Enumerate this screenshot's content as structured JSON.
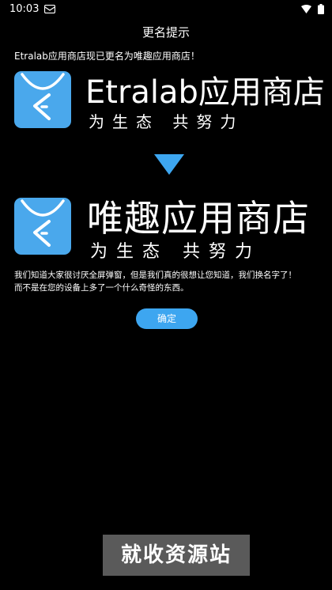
{
  "status_bar": {
    "time": "10:03",
    "icons": [
      "notification-icon",
      "wifi-icon",
      "battery-icon"
    ]
  },
  "dialog": {
    "title": "更名提示",
    "notice": "Etralab应用商店现已更名为唯趣应用商店！",
    "old_brand": {
      "name": "Etralab应用商店",
      "slogan": "为生态 共努力"
    },
    "new_brand": {
      "name": "唯趣应用商店",
      "slogan": "为生态 共努力"
    },
    "body_line1": "我们知道大家很讨厌全屏弹窗，但是我们真的很想让您知道，我们换名字了！",
    "body_line2": "而不是在您的设备上多了一个什么奇怪的东西。",
    "confirm_label": "确定"
  },
  "watermark": "就收资源站",
  "colors": {
    "background": "#000000",
    "accent": "#3da6f0",
    "logo": "#4aa8ec"
  }
}
